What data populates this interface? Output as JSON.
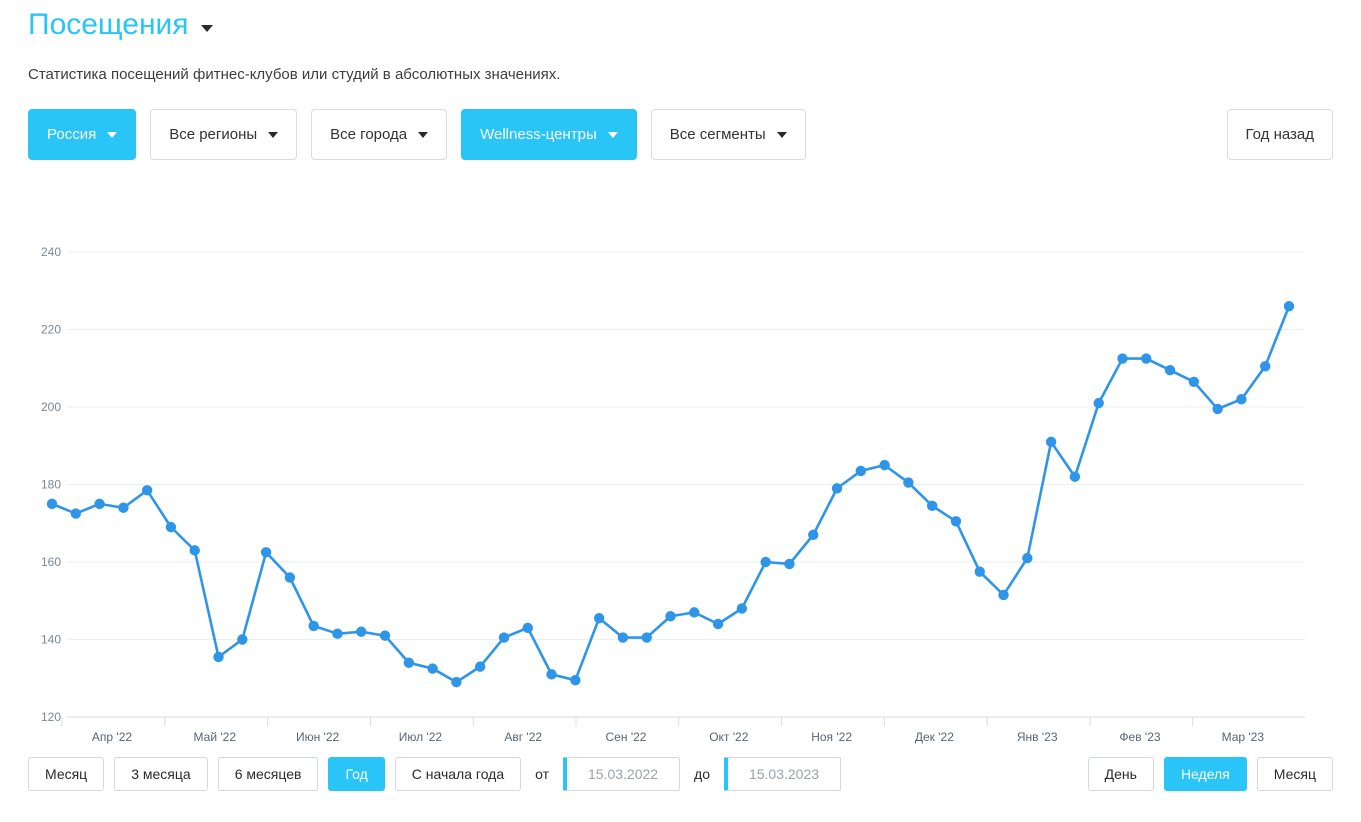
{
  "header": {
    "title": "Посещения",
    "title_caret_icon": "chevron-down-icon",
    "subtitle": "Статистика посещений фитнес-клубов или студий в абсолютных значениях."
  },
  "filters": [
    {
      "label": "Россия",
      "active": true,
      "caret": "chevron-down-icon"
    },
    {
      "label": "Все регионы",
      "active": false,
      "caret": "chevron-down-icon"
    },
    {
      "label": "Все города",
      "active": false,
      "caret": "chevron-down-icon"
    },
    {
      "label": "Wellness-центры",
      "active": true,
      "caret": "chevron-down-icon"
    },
    {
      "label": "Все сегменты",
      "active": false,
      "caret": "chevron-down-icon"
    }
  ],
  "compare_button": {
    "label": "Год назад"
  },
  "bottom": {
    "ranges": [
      {
        "label": "Месяц",
        "active": false
      },
      {
        "label": "3 месяца",
        "active": false
      },
      {
        "label": "6 месяцев",
        "active": false
      },
      {
        "label": "Год",
        "active": true
      },
      {
        "label": "С начала года",
        "active": false
      }
    ],
    "date_from_label": "от",
    "date_from_value": "15.03.2022",
    "date_to_label": "до",
    "date_to_value": "15.03.2023",
    "granularity": [
      {
        "label": "День",
        "active": false
      },
      {
        "label": "Неделя",
        "active": true
      },
      {
        "label": "Месяц",
        "active": false
      }
    ]
  },
  "colors": {
    "accent": "#29c5f6",
    "line": "#2e95e8",
    "grid": "#eceef0",
    "axis": "#d7dce0",
    "tick_text": "#7b8894"
  },
  "chart_data": {
    "type": "line",
    "title": "Посещения",
    "xlabel": "",
    "ylabel": "",
    "ylim": [
      120,
      240
    ],
    "yticks": [
      120,
      140,
      160,
      180,
      200,
      220,
      240
    ],
    "grid": true,
    "legend": "none",
    "xtick_labels": [
      "Апр '22",
      "Май '22",
      "Июн '22",
      "Июл '22",
      "Авг '22",
      "Сен '22",
      "Окт '22",
      "Ноя '22",
      "Дек '22",
      "Янв '23",
      "Фев '23",
      "Мар '23"
    ],
    "series": [
      {
        "name": "Посещения",
        "color": "#2e95e8",
        "values": [
          175.0,
          172.5,
          175.0,
          174.0,
          178.5,
          169.0,
          163.0,
          135.5,
          140.0,
          162.5,
          156.0,
          143.5,
          141.5,
          142.0,
          141.0,
          134.0,
          132.5,
          129.0,
          133.0,
          140.5,
          143.0,
          131.0,
          129.5,
          145.5,
          140.5,
          140.5,
          146.0,
          147.0,
          144.0,
          148.0,
          160.0,
          159.5,
          167.0,
          179.0,
          183.5,
          185.0,
          180.5,
          174.5,
          170.5,
          157.5,
          151.5,
          161.0,
          191.0,
          182.0,
          201.0,
          212.5,
          212.5,
          209.5,
          206.5,
          199.5,
          202.0,
          210.5,
          226.0
        ]
      }
    ]
  }
}
